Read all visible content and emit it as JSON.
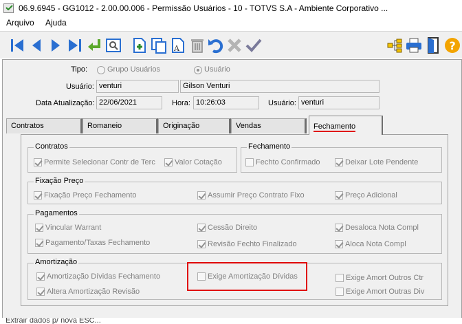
{
  "window": {
    "title": "06.9.6945 - GG1012 - 2.00.00.006 - Permissão Usuários - 10 - TOTVS S.A - Ambiente Corporativo ..."
  },
  "menu": {
    "items": [
      "Arquivo",
      "Ajuda"
    ]
  },
  "form": {
    "tipo_label": "Tipo:",
    "tipo_options": [
      "Grupo Usuários",
      "Usuário"
    ],
    "tipo_selected": "Usuário",
    "usuario_label": "Usuário:",
    "usuario_code": "venturi",
    "usuario_name": "Gilson Venturi",
    "data_label": "Data Atualização:",
    "data_value": "22/06/2021",
    "hora_label": "Hora:",
    "hora_value": "10:26:03",
    "usuario2_label": "Usuário:",
    "usuario2_value": "venturi"
  },
  "tabs": [
    "Contratos",
    "Romaneio",
    "Originação",
    "Vendas",
    "Fechamento"
  ],
  "active_tab": "Fechamento",
  "groups": {
    "contratos": {
      "title": "Contratos",
      "items": [
        {
          "label": "Permite Selecionar Contr de Terc",
          "checked": true
        },
        {
          "label": "Valor Cotação",
          "checked": true
        }
      ]
    },
    "fechamento": {
      "title": "Fechamento",
      "items": [
        {
          "label": "Fechto Confirmado",
          "checked": false
        },
        {
          "label": "Deixar Lote Pendente",
          "checked": true
        }
      ]
    },
    "fixacao": {
      "title": "Fixação Preço",
      "items": [
        {
          "label": "Fixação Preço Fechamento",
          "checked": true
        },
        {
          "label": "Assumir Preço Contrato Fixo",
          "checked": true
        },
        {
          "label": "Preço Adicional",
          "checked": true
        }
      ]
    },
    "pagamentos": {
      "title": "Pagamentos",
      "items": [
        {
          "label": "Vincular Warrant",
          "checked": true
        },
        {
          "label": "Cessão Direito",
          "checked": true
        },
        {
          "label": "Desaloca Nota Compl",
          "checked": true
        },
        {
          "label": "Pagamento/Taxas Fechamento",
          "checked": true
        },
        {
          "label": "Revisão Fechto Finalizado",
          "checked": true
        },
        {
          "label": "Aloca Nota Compl",
          "checked": true
        }
      ]
    },
    "amortizacao": {
      "title": "Amortização",
      "items": [
        {
          "label": "Amortização Dívidas Fechamento",
          "checked": true
        },
        {
          "label": "Exige Amortização Dívidas",
          "checked": false
        },
        {
          "label": "Exige Amort Outros Ctr",
          "checked": false
        },
        {
          "label": "Altera Amortização Revisão",
          "checked": true
        },
        {
          "label": "Exige Amort Outras Div",
          "checked": false
        }
      ]
    }
  },
  "status": {
    "text": "Extrair dados p/ nova ESC..."
  },
  "colors": {
    "accent_red": "#e00000",
    "toolbar_blue": "#2a6fd1",
    "help_orange": "#f3a400"
  },
  "toolbar_icons": [
    "first-record-icon",
    "previous-record-icon",
    "next-record-icon",
    "last-record-icon",
    "goto-icon",
    "search-icon",
    "new-record-icon",
    "copy-record-icon",
    "edit-record-icon",
    "delete-record-icon",
    "undo-icon",
    "cancel-icon",
    "confirm-icon",
    "tree-icon",
    "print-icon",
    "exit-icon",
    "help-icon"
  ]
}
